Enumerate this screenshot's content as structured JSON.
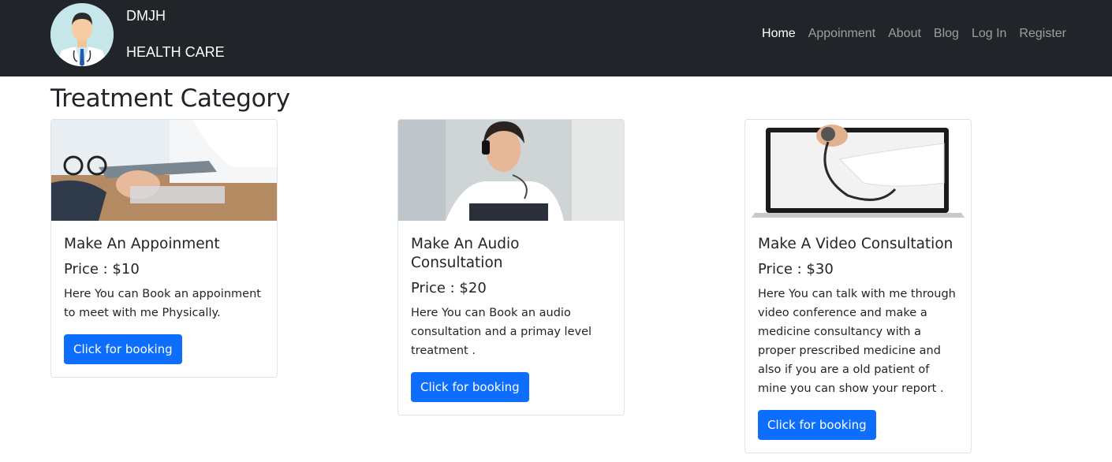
{
  "brand": {
    "name": "DMJH",
    "subtitle": "HEALTH CARE"
  },
  "nav": {
    "items": [
      {
        "label": "Home",
        "active": true
      },
      {
        "label": "Appoinment",
        "active": false
      },
      {
        "label": "About",
        "active": false
      },
      {
        "label": "Blog",
        "active": false
      },
      {
        "label": "Log In",
        "active": false
      },
      {
        "label": "Register",
        "active": false
      }
    ]
  },
  "page": {
    "title": "Treatment Category"
  },
  "cards": [
    {
      "title": "Make An Appoinment",
      "price": "Price : $10",
      "description": "Here You can Book an appoinment to meet with me Physically.",
      "button": "Click for booking"
    },
    {
      "title": "Make An Audio Consultation",
      "price": "Price : $20",
      "description": "Here You can Book an audio consultation and a primay level treatment .",
      "button": "Click for booking"
    },
    {
      "title": "Make A Video Consultation",
      "price": "Price : $30",
      "description": "Here You can talk with me through video conference and make a medicine consultancy with a proper prescribed medicine and also if you are a old patient of mine you can show your report .",
      "button": "Click for booking"
    }
  ],
  "colors": {
    "navbar_bg": "#212529",
    "button_bg": "#0d6efd",
    "text": "#212529"
  }
}
